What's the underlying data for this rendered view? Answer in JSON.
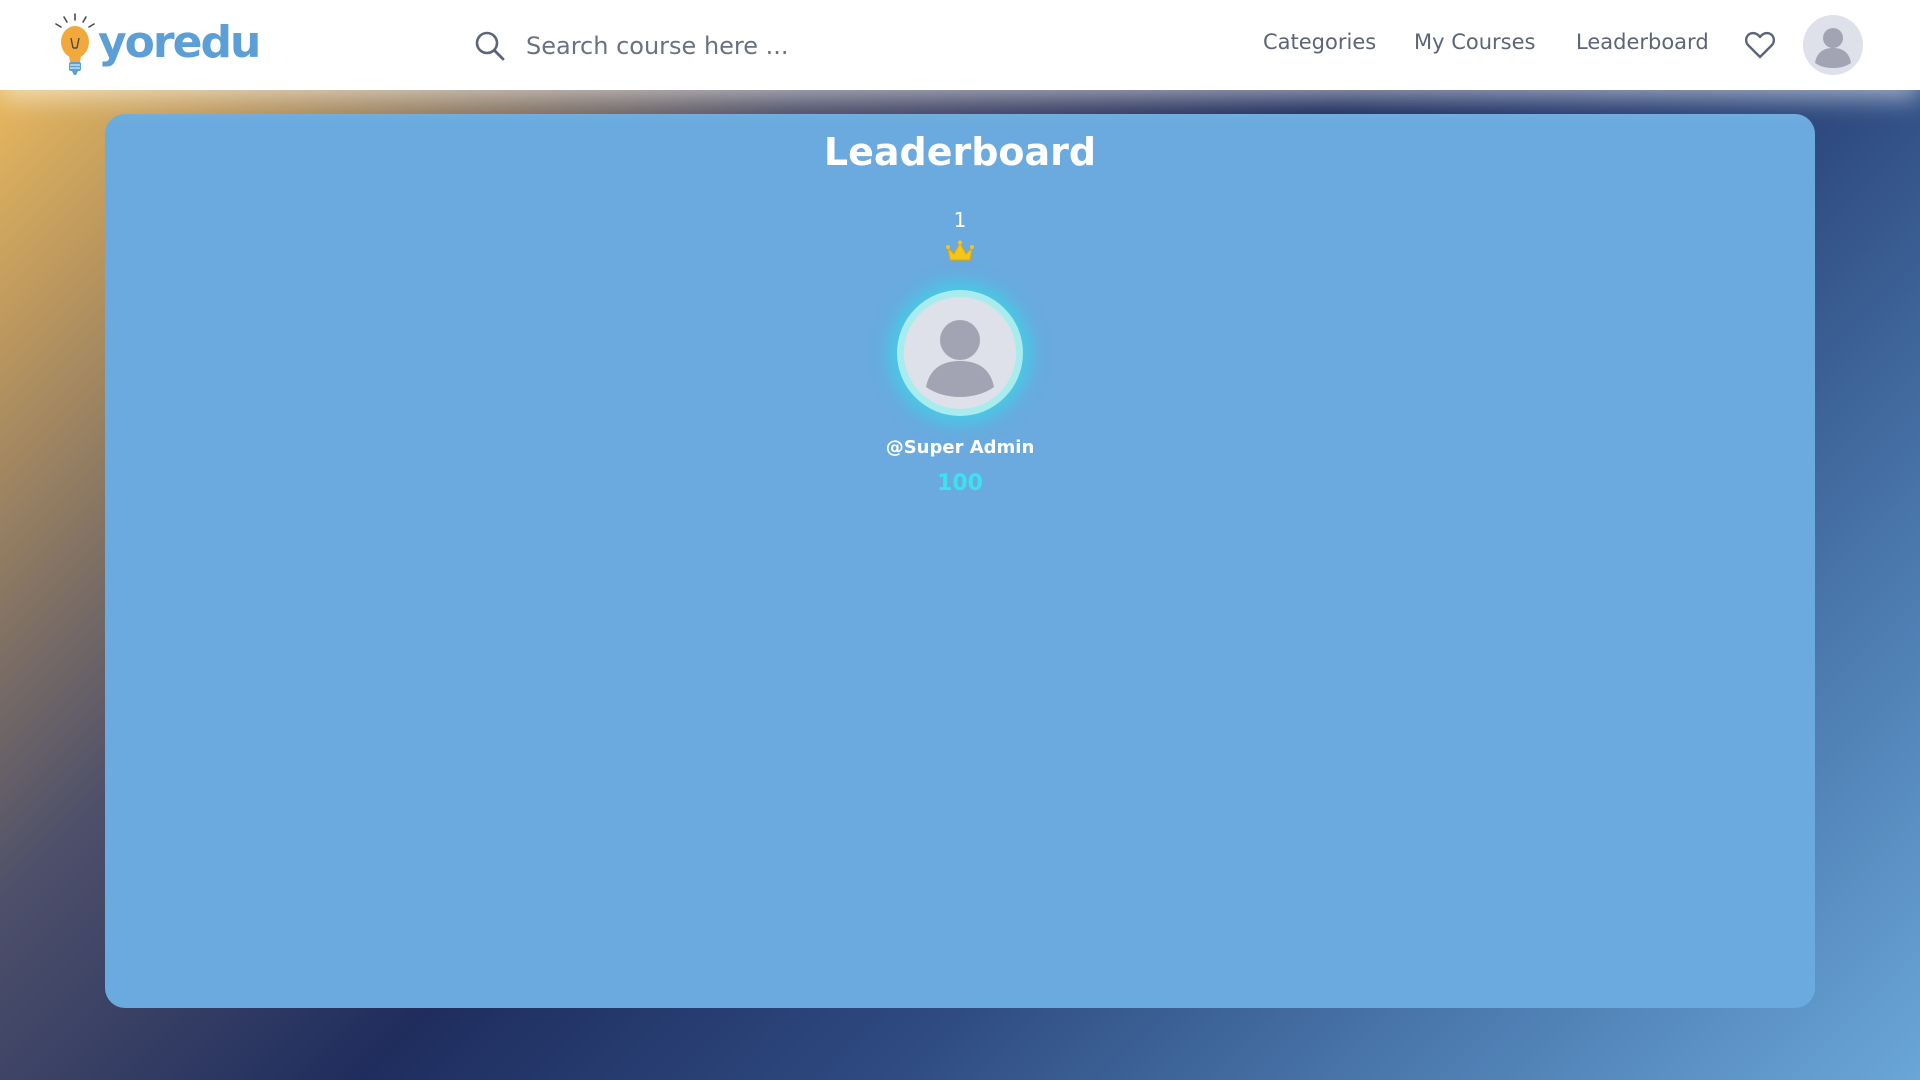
{
  "header": {
    "logo_text": "yoredu",
    "search": {
      "placeholder": "Search course here ..."
    },
    "nav": {
      "categories": "Categories",
      "my_courses": "My Courses",
      "leaderboard": "Leaderboard"
    },
    "icons": {
      "search": "search-icon",
      "favorites": "heart-icon",
      "profile": "user-avatar-icon",
      "logo": "lightbulb-logo-icon"
    }
  },
  "leaderboard": {
    "title": "Leaderboard",
    "entries": [
      {
        "rank": "1",
        "name": "@Super Admin",
        "score": "100"
      }
    ]
  },
  "colors": {
    "brand": "#5b9fd6",
    "card": "#6aaade",
    "score": "#3ee2ef",
    "crown": "#f5c518"
  }
}
